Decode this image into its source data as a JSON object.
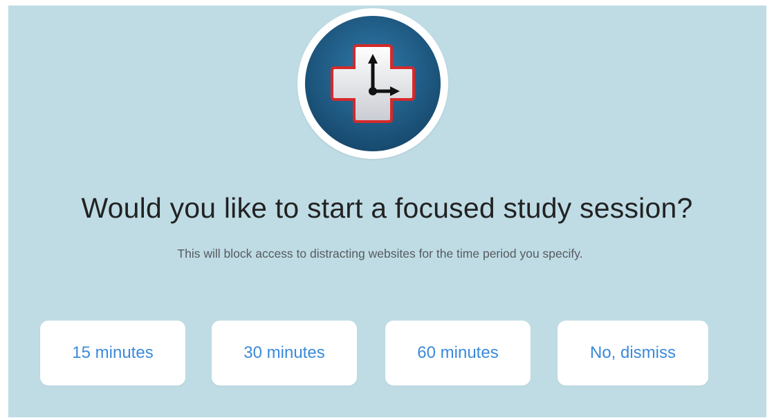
{
  "dialog": {
    "logo_icon": "medical-cross-clock-icon",
    "title": "Would you like to start a focused study session?",
    "subtitle": "This will block access to distracting websites for the time period you specify.",
    "buttons": {
      "b15": "15 minutes",
      "b30": "30 minutes",
      "b60": "60 minutes",
      "dismiss": "No, dismiss"
    }
  },
  "colors": {
    "background": "#bfdce5",
    "logo_circle": "#1f5f8b",
    "cross_border": "#d42a2a",
    "button_text": "#3b8ad9",
    "title_text": "#222222"
  }
}
